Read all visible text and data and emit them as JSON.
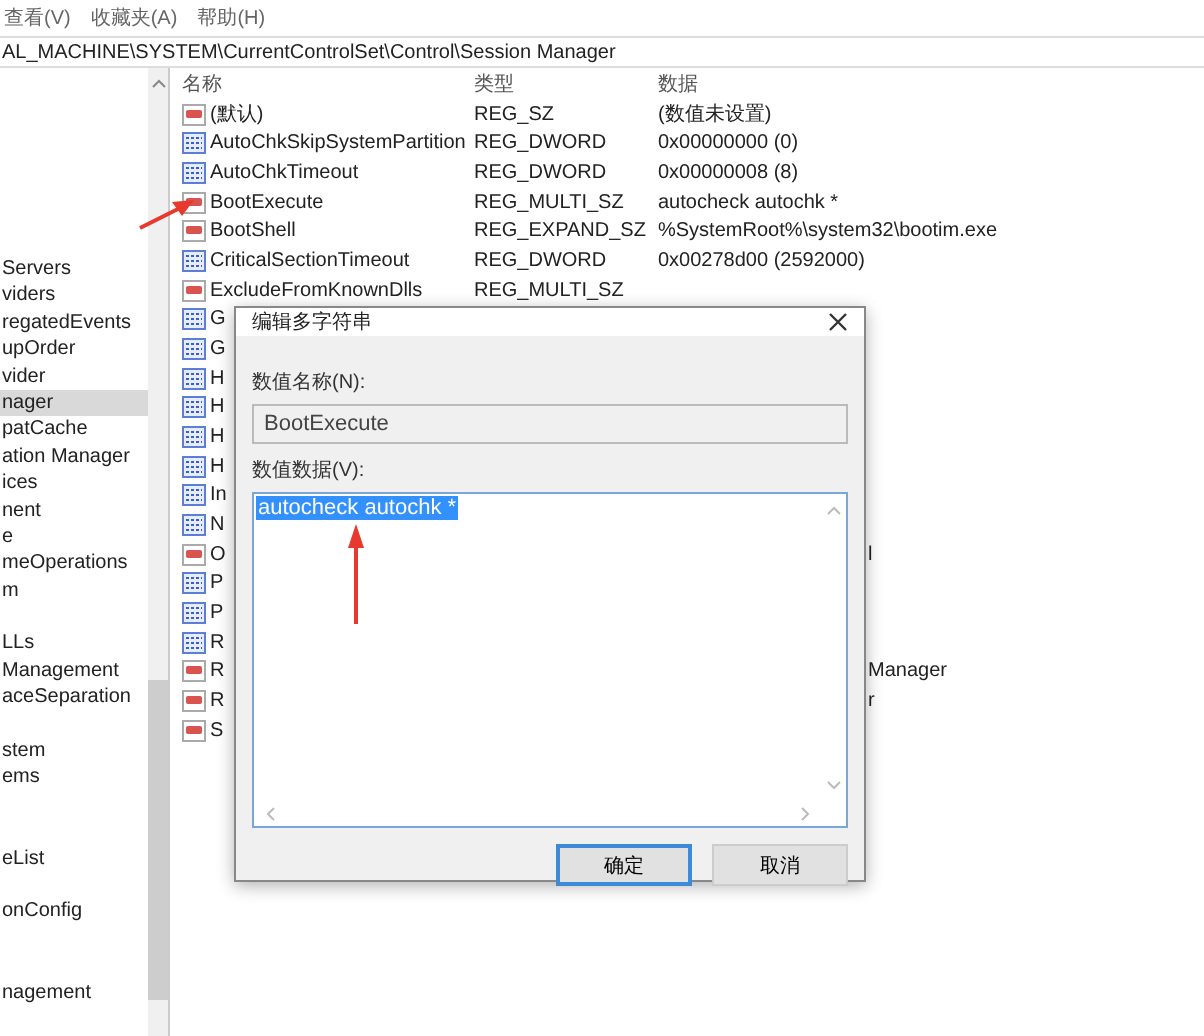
{
  "menu": [
    "查看(V)",
    "收藏夹(A)",
    "帮助(H)"
  ],
  "address": "AL_MACHINE\\SYSTEM\\CurrentControlSet\\Control\\Session Manager",
  "tree": {
    "groups": [
      [
        {
          "label": "Servers",
          "selected": false
        },
        {
          "label": "viders",
          "selected": false
        },
        {
          "label": "regatedEvents",
          "selected": false
        },
        {
          "label": "upOrder",
          "selected": false
        },
        {
          "label": "vider",
          "selected": false
        },
        {
          "label": "nager",
          "selected": true
        },
        {
          "label": "patCache",
          "selected": false
        },
        {
          "label": "ation Manager",
          "selected": false
        },
        {
          "label": "ices",
          "selected": false
        },
        {
          "label": "nent",
          "selected": false
        },
        {
          "label": "e",
          "selected": false
        },
        {
          "label": "meOperations",
          "selected": false
        },
        {
          "label": "m",
          "selected": false
        }
      ],
      [
        {
          "label": "LLs",
          "selected": false
        },
        {
          "label": "Management",
          "selected": false
        },
        {
          "label": "aceSeparation",
          "selected": false
        }
      ],
      [
        {
          "label": "stem",
          "selected": false
        },
        {
          "label": "ems",
          "selected": false
        }
      ],
      [
        {
          "label": "eList",
          "selected": false
        }
      ],
      [
        {
          "label": "onConfig",
          "selected": false
        }
      ],
      [
        {
          "label": "nagement",
          "selected": false
        }
      ]
    ]
  },
  "list": {
    "columns": [
      "名称",
      "类型",
      "数据"
    ],
    "rows": [
      {
        "kind": "string",
        "name": "(默认)",
        "type": "REG_SZ",
        "data": "(数值未设置)"
      },
      {
        "kind": "binary",
        "name": "AutoChkSkipSystemPartition",
        "type": "REG_DWORD",
        "data": "0x00000000 (0)"
      },
      {
        "kind": "binary",
        "name": "AutoChkTimeout",
        "type": "REG_DWORD",
        "data": "0x00000008 (8)"
      },
      {
        "kind": "string",
        "name": "BootExecute",
        "type": "REG_MULTI_SZ",
        "data": "autocheck autochk *"
      },
      {
        "kind": "string",
        "name": "BootShell",
        "type": "REG_EXPAND_SZ",
        "data": "%SystemRoot%\\system32\\bootim.exe"
      },
      {
        "kind": "binary",
        "name": "CriticalSectionTimeout",
        "type": "REG_DWORD",
        "data": "0x00278d00 (2592000)"
      },
      {
        "kind": "string",
        "name": "ExcludeFromKnownDlls",
        "type": "REG_MULTI_SZ"
      },
      {
        "kind": "binary",
        "name": "G"
      },
      {
        "kind": "binary",
        "name": "G"
      },
      {
        "kind": "binary",
        "name": "H"
      },
      {
        "kind": "binary",
        "name": "H"
      },
      {
        "kind": "binary",
        "name": "H"
      },
      {
        "kind": "binary",
        "name": "H"
      },
      {
        "kind": "binary",
        "name": "In"
      },
      {
        "kind": "binary",
        "name": "N"
      },
      {
        "kind": "string",
        "name": "O",
        "data_tail": "l"
      },
      {
        "kind": "binary",
        "name": "P"
      },
      {
        "kind": "binary",
        "name": "P"
      },
      {
        "kind": "binary",
        "name": "R"
      },
      {
        "kind": "string",
        "name": "R",
        "data_tail": "Manager"
      },
      {
        "kind": "string",
        "name": "R",
        "data_tail": "r"
      },
      {
        "kind": "string",
        "name": "S"
      }
    ]
  },
  "dialog": {
    "title": "编辑多字符串",
    "name_label": "数值名称(N):",
    "name_value": "BootExecute",
    "data_label": "数值数据(V):",
    "data_value": "autocheck autochk *",
    "data_selected": true,
    "buttons": [
      {
        "label": "确定",
        "default": true
      },
      {
        "label": "取消",
        "default": false
      }
    ]
  }
}
